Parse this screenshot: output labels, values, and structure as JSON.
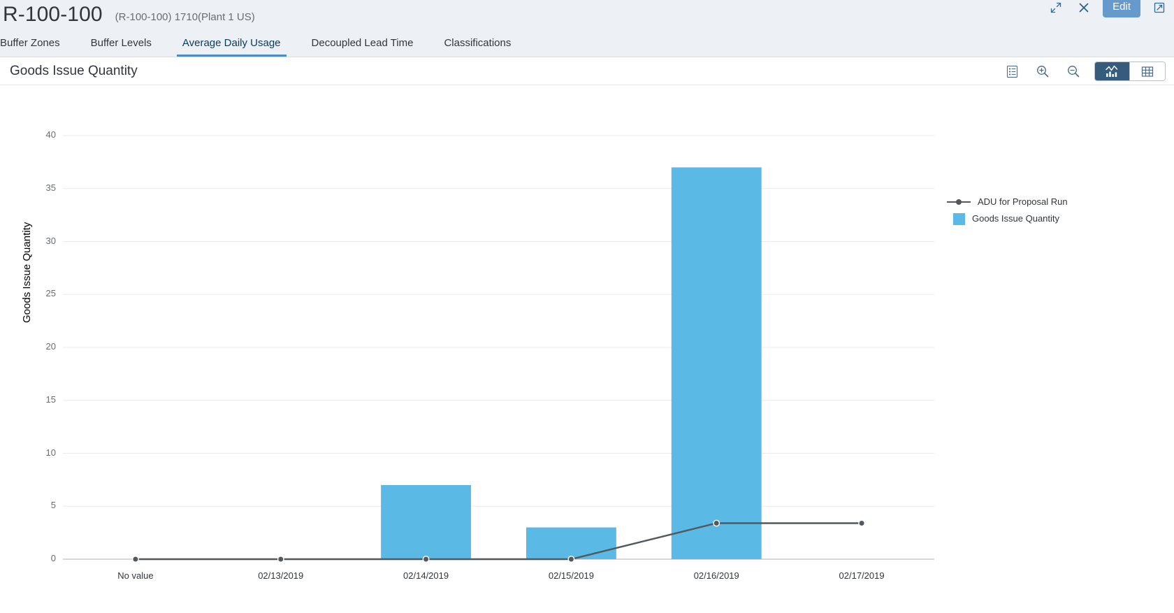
{
  "header": {
    "title": "R-100-100",
    "subtitle": "(R-100-100) 1710(Plant 1 US)",
    "actions": {
      "fullscreen_icon": "expand-icon",
      "close_icon": "close-icon",
      "edit_label": "Edit",
      "share_icon": "share-icon"
    }
  },
  "tabs": [
    {
      "label": "Buffer Zones",
      "selected": false
    },
    {
      "label": "Buffer Levels",
      "selected": false
    },
    {
      "label": "Average Daily Usage",
      "selected": true
    },
    {
      "label": "Decoupled Lead Time",
      "selected": false
    },
    {
      "label": "Classifications",
      "selected": false
    }
  ],
  "card": {
    "title": "Goods Issue Quantity",
    "tools": [
      {
        "name": "details-list-icon",
        "label": "Details"
      },
      {
        "name": "zoom-in-icon",
        "label": "Zoom In"
      },
      {
        "name": "zoom-out-icon",
        "label": "Zoom Out"
      }
    ],
    "view_toggle": [
      {
        "name": "chart-view-icon",
        "label": "Chart View",
        "active": true
      },
      {
        "name": "table-view-icon",
        "label": "Table View",
        "active": false
      }
    ]
  },
  "chart_data": {
    "type": "bar",
    "title": "Goods Issue Quantity",
    "xlabel": "",
    "ylabel": "Goods Issue Quantity",
    "ylim": [
      0,
      40
    ],
    "yticks": [
      0,
      5,
      10,
      15,
      20,
      25,
      30,
      35,
      40
    ],
    "grid": true,
    "legend_position": "right",
    "categories": [
      "No value",
      "02/13/2019",
      "02/14/2019",
      "02/15/2019",
      "02/16/2019",
      "02/17/2019"
    ],
    "series": [
      {
        "name": "Goods Issue Quantity",
        "type": "bar",
        "color": "#5bbae5",
        "values": [
          0,
          0,
          7,
          3,
          37,
          0
        ]
      },
      {
        "name": "ADU for Proposal Run",
        "type": "line",
        "color": "#53585c",
        "values": [
          0,
          0,
          0,
          0,
          3.4,
          3.4
        ]
      }
    ]
  }
}
